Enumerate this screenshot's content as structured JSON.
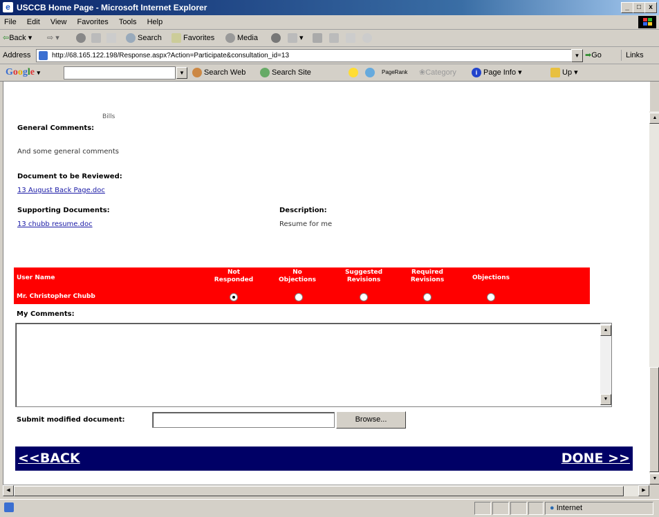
{
  "window": {
    "title": "USCCB Home Page - Microsoft Internet Explorer",
    "minimize": "_",
    "maximize": "□",
    "close": "x"
  },
  "menu": [
    "File",
    "Edit",
    "View",
    "Favorites",
    "Tools",
    "Help"
  ],
  "toolbar": {
    "back": "Back",
    "search": "Search",
    "favorites": "Favorites",
    "media": "Media"
  },
  "address": {
    "label": "Address",
    "url": "http://68.165.122.198/Response.aspx?Action=Participate&consultation_id=13",
    "go": "Go",
    "links": "Links"
  },
  "google": {
    "logo": "Google",
    "search_web": "Search Web",
    "search_site": "Search Site",
    "pagerank": "PageRank",
    "category": "Category",
    "page_info": "Page Info",
    "up": "Up"
  },
  "page": {
    "top_fragment": "Bills",
    "general_comments_label": "General Comments:",
    "general_comments_text": "And some general comments",
    "doc_review_label": "Document to be Reviewed:",
    "doc_review_link": "13 August Back Page.doc",
    "supporting_label": "Supporting Documents:",
    "supporting_link": "13 chubb resume.doc",
    "description_label": "Description:",
    "description_text": "Resume for me",
    "table": {
      "headers": {
        "user_name": "User Name",
        "not_responded_1": "Not",
        "not_responded_2": "Responded",
        "no_objections_1": "No",
        "no_objections_2": "Objections",
        "suggested_1": "Suggested",
        "suggested_2": "Revisions",
        "required_1": "Required",
        "required_2": "Revisions",
        "objections": "Objections"
      },
      "row_user": "Mr. Christopher Chubb",
      "selected_option": "Not Responded"
    },
    "my_comments_label": "My Comments:",
    "my_comments_value": "",
    "submit_label": "Submit modified document:",
    "browse": "Browse...",
    "back": "<<BACK",
    "done": "DONE >>"
  },
  "status": {
    "zone": "Internet"
  }
}
